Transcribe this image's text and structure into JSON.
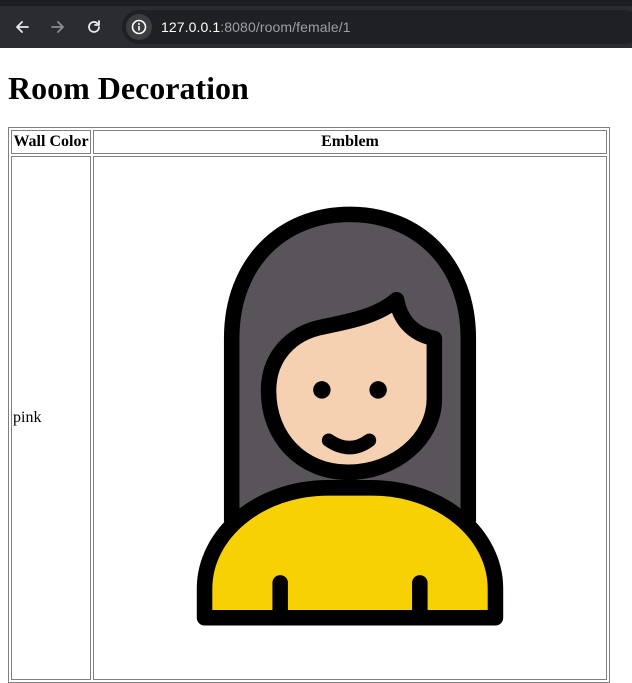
{
  "browser": {
    "url_host": "127.0.0.1",
    "url_rest": ":8080/room/female/1"
  },
  "page": {
    "title": "Room Decoration"
  },
  "table": {
    "headers": [
      "Wall Color",
      "Emblem"
    ],
    "rows": [
      {
        "wall_color": "pink",
        "emblem_icon": "female-avatar-icon"
      }
    ]
  },
  "colors": {
    "hair": "#58545a",
    "skin": "#f5d0b1",
    "shirt": "#f7d103",
    "outline": "#000000"
  }
}
